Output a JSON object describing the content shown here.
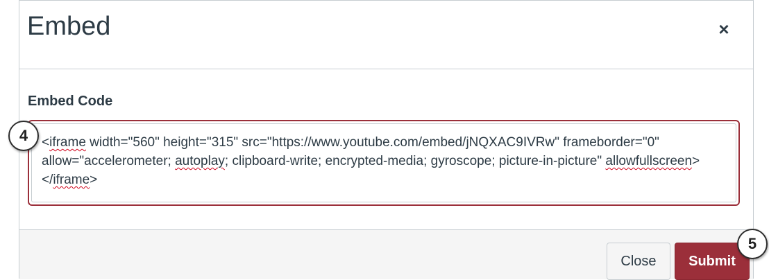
{
  "dialog": {
    "title": "Embed",
    "close_icon_glyph": "×",
    "field_label": "Embed Code",
    "embed_code": {
      "seg1": "<",
      "seg2": "iframe",
      "seg3": " width=\"560\" height=\"315\" src=\"https://www.youtube.com/embed/jNQXAC9IVRw\" frameborder=\"0\" allow=\"accelerometer; ",
      "seg4": "autoplay",
      "seg5": "; clipboard-write; encrypted-media; gyroscope; picture-in-picture\" ",
      "seg6": "allowfullscreen",
      "seg7": "></",
      "seg8": "iframe",
      "seg9": ">"
    },
    "close_button": "Close",
    "submit_button": "Submit"
  },
  "callouts": {
    "step4": "4",
    "step5": "5"
  },
  "colors": {
    "accent": "#9b2f3a",
    "text": "#2d3b45",
    "border": "#c7cdd1",
    "footer_bg": "#f5f5f5"
  }
}
